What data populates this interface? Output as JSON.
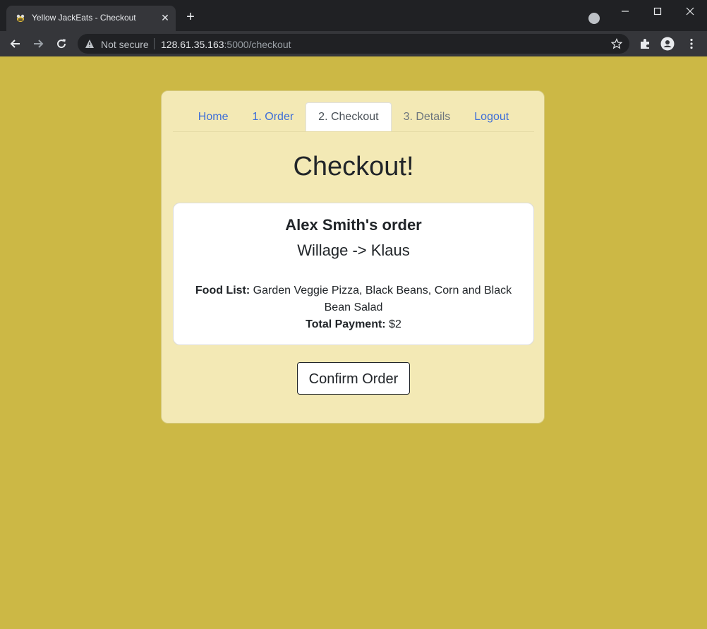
{
  "browser": {
    "tab_title": "Yellow JackEats - Checkout",
    "security_label": "Not secure",
    "url_host": "128.61.35.163",
    "url_rest": ":5000/checkout"
  },
  "nav": {
    "items": [
      {
        "label": "Home"
      },
      {
        "label": "1. Order"
      },
      {
        "label": "2. Checkout"
      },
      {
        "label": "3. Details"
      },
      {
        "label": "Logout"
      }
    ]
  },
  "page": {
    "heading": "Checkout!"
  },
  "order": {
    "title": "Alex Smith's order",
    "route": "Willage -> Klaus",
    "food_list_label": "Food List:",
    "food_list_value": "Garden Veggie Pizza, Black Beans, Corn and Black Bean Salad",
    "total_label": "Total Payment:",
    "total_value": "$2"
  },
  "actions": {
    "confirm_label": "Confirm Order"
  },
  "colors": {
    "page_background": "#ccb845",
    "card_background": "#f3e9b5",
    "link": "#3d6ed8"
  }
}
